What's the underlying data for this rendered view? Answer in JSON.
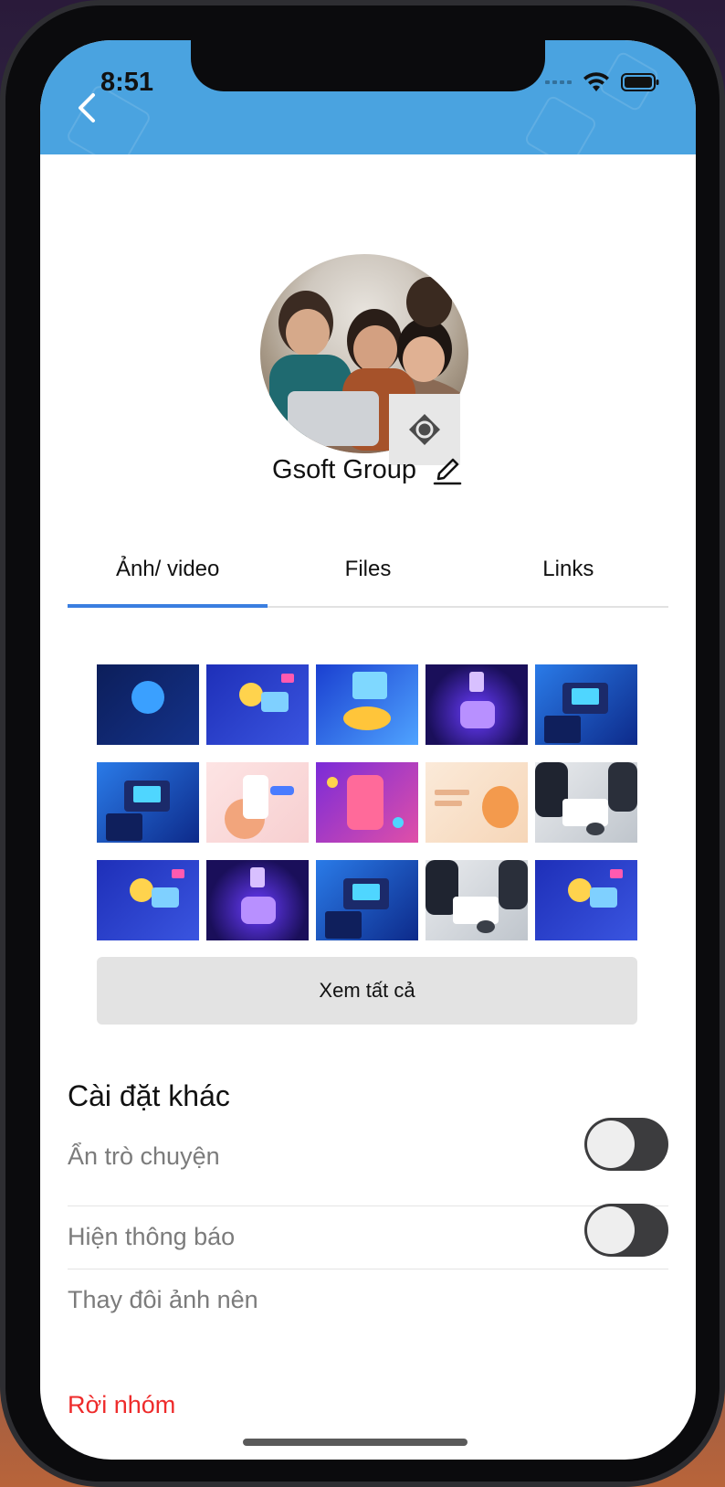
{
  "status_bar": {
    "time": "8:51"
  },
  "header": {
    "accent_color": "#4aa3e0"
  },
  "group": {
    "name": "Gsoft Group"
  },
  "tabs": [
    {
      "label": "Ảnh/ video",
      "active": true
    },
    {
      "label": "Files",
      "active": false
    },
    {
      "label": "Links",
      "active": false
    }
  ],
  "media_thumbnails": [
    {
      "theme": "bitcoin-dark-blue"
    },
    {
      "theme": "crypto-people-blue"
    },
    {
      "theme": "coins-blue"
    },
    {
      "theme": "ethereum-purple"
    },
    {
      "theme": "isometric-laptop-blue"
    },
    {
      "theme": "isometric-laptop-blue"
    },
    {
      "theme": "phone-hands-pink"
    },
    {
      "theme": "phone-apps-purple"
    },
    {
      "theme": "landing-page-peach"
    },
    {
      "theme": "business-meeting-photo"
    },
    {
      "theme": "crypto-people-blue"
    },
    {
      "theme": "ethereum-purple"
    },
    {
      "theme": "isometric-laptop-blue"
    },
    {
      "theme": "business-meeting-photo"
    },
    {
      "theme": "crypto-people-blue"
    }
  ],
  "see_all_label": "Xem tất cả",
  "settings": {
    "title": "Cài đặt khác",
    "hide_chat_label": "Ẩn trò chuyện",
    "hide_chat_on": false,
    "show_notifications_label": "Hiện thông báo",
    "show_notifications_on": false,
    "change_background_label": "Thay đôi ảnh nên",
    "leave_group_label": "Rời nhóm",
    "leave_color": "#ee2b2b"
  }
}
